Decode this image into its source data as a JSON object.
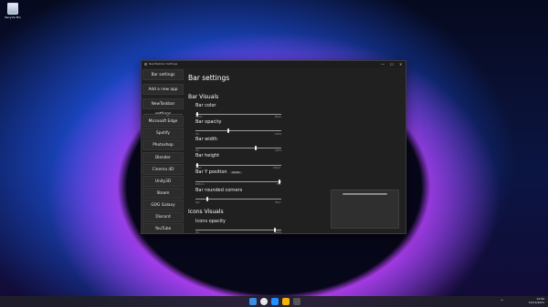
{
  "desktop": {
    "recycle_bin_label": "Recycle Bin"
  },
  "window": {
    "title": "NewTaskbar Settings",
    "controls": {
      "minimize": "—",
      "maximize": "☐",
      "close": "✕"
    }
  },
  "sidebar": {
    "top_items": [
      "Bar settings",
      "Add a new app",
      "NewTaskbar settings"
    ],
    "apps": [
      "Microsoft Edge",
      "Spotify",
      "Photoshop",
      "Blender",
      "Cinema 4D",
      "Unity3D",
      "Steam",
      "GOG Galaxy",
      "Discord",
      "YouTube"
    ]
  },
  "content": {
    "title": "Bar settings",
    "section_visuals": "Bar Visuals",
    "bar_color": {
      "label": "Bar color",
      "min": "White",
      "max": "Black",
      "value": 0.02
    },
    "bar_opacity": {
      "label": "Bar opacity",
      "min": "0%",
      "max": "100%",
      "value": 0.38
    },
    "bar_width": {
      "label": "Bar width",
      "min": "0%",
      "max": "100%",
      "value": 0.7
    },
    "bar_height": {
      "label": "Bar height",
      "min": "20px",
      "max": "100px",
      "value": 0.02
    },
    "bar_y_position": {
      "label": "Bar Y position",
      "badge": "Center",
      "min": "Bottom",
      "max": "Top",
      "value": 0.98
    },
    "bar_rounded_corners": {
      "label": "Bar rounded corners",
      "min": "0px",
      "max": "50px",
      "value": 0.14
    },
    "section_icons": "Icons Visuals",
    "icons_opacity": {
      "label": "Icons opacity",
      "min": "0%",
      "max": "100%",
      "value": 0.93
    }
  },
  "taskbar": {
    "tray_chevron": "^",
    "time": "12:00",
    "date": "15/11/2021"
  }
}
